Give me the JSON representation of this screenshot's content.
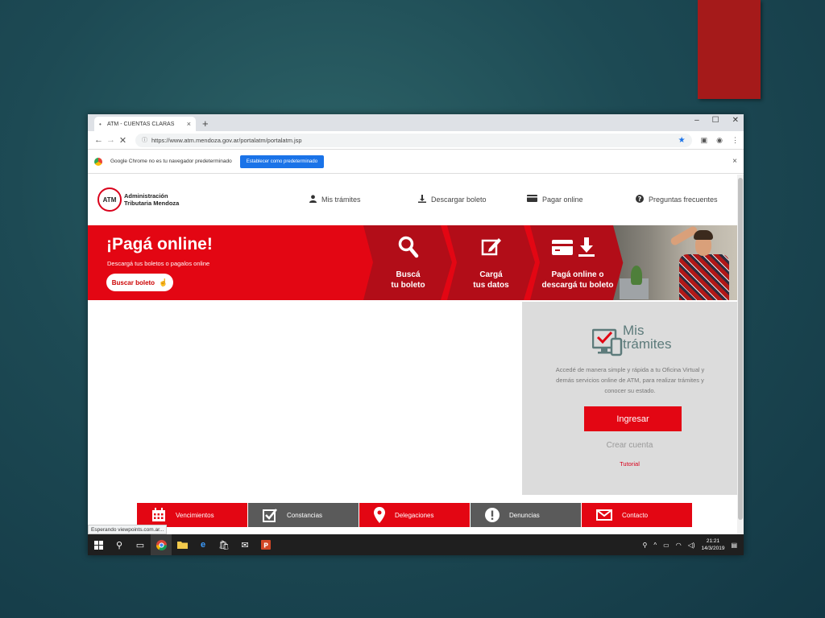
{
  "browser": {
    "tab_title": "ATM - CUENTAS CLARAS",
    "tab_close": "×",
    "new_tab": "+",
    "url": "https://www.atm.mendoza.gov.ar/portalatm/portalatm.jsp",
    "win_minimize": "–",
    "win_maximize": "☐",
    "win_close": "✕",
    "infobar_text": "Google Chrome no es tu navegador predeterminado",
    "infobar_button": "Establecer como predeterminado",
    "infobar_close": "×",
    "status_text": "Esperando viewpoints.com.ar..."
  },
  "site": {
    "logo_badge": "ATM",
    "logo_line1": "Administración",
    "logo_line2": "Tributaria Mendoza",
    "menu": {
      "mis_tramites": "Mis trámites",
      "descargar_boleto": "Descargar boleto",
      "pagar_online": "Pagar online",
      "preguntas": "Preguntas frecuentes"
    },
    "hero": {
      "title": "¡Pagá online!",
      "subtitle": "Descargá tus boletos o pagalos online",
      "button": "Buscar boleto",
      "step1_line1": "Buscá",
      "step1_line2": "tu boleto",
      "step2_line1": "Cargá",
      "step2_line2": "tus datos",
      "step3_line1": "Pagá online o",
      "step3_line2": "descargá tu boleto"
    },
    "tramites": {
      "heading1": "Mis",
      "heading2": "trámites",
      "description": "Accedé de manera simple y rápida a tu Oficina Virtual y demás servicios online de ATM, para realizar trámites y conocer su estado.",
      "ingresar": "Ingresar",
      "crear_cuenta": "Crear cuenta",
      "tutorial": "Tutorial"
    },
    "bottom_nav": {
      "vencimientos": "Vencimientos",
      "constancias": "Constancias",
      "delegaciones": "Delegaciones",
      "denuncias": "Denuncias",
      "contacto": "Contacto"
    }
  },
  "taskbar": {
    "time": "21:21",
    "date": "14/3/2019"
  },
  "colors": {
    "atm_red": "#e30613",
    "dark_red_tab": "#a51a1a",
    "nav_gray": "#5a5a5a",
    "panel_gray": "#dcdcdc",
    "chrome_blue": "#1a73e8"
  }
}
